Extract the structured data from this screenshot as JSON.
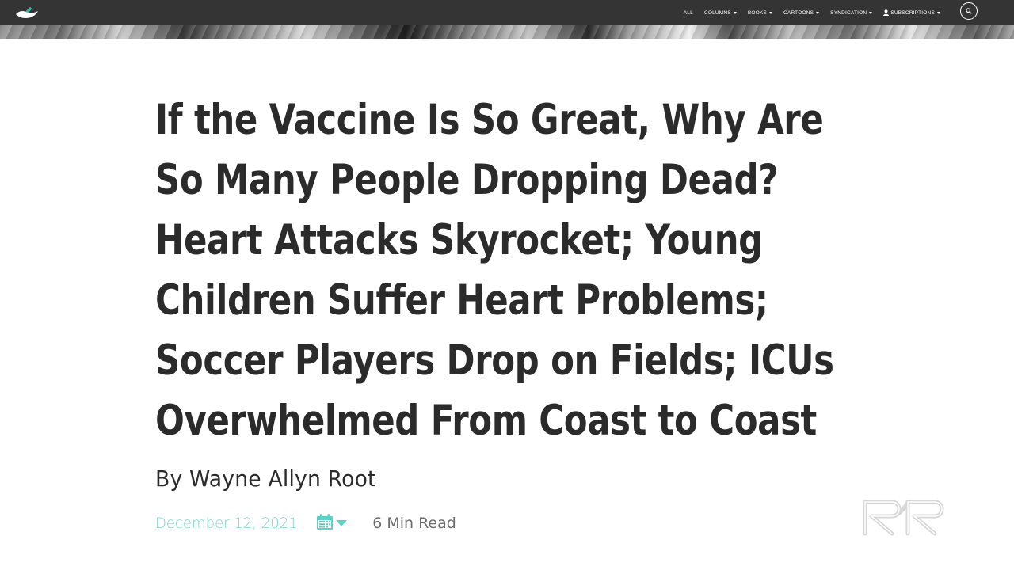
{
  "navbar": {
    "logo_icon": "bird-logo-icon",
    "items": [
      {
        "label": "ALL",
        "has_dropdown": false
      },
      {
        "label": "COLUMNS",
        "has_dropdown": true
      },
      {
        "label": "BOOKS",
        "has_dropdown": true
      },
      {
        "label": "CARTOONS",
        "has_dropdown": true
      },
      {
        "label": "SYNDICATION",
        "has_dropdown": true
      },
      {
        "label": "SUBSCRIPTIONS",
        "has_dropdown": true,
        "icon": "user-icon"
      }
    ],
    "search_icon": "search-icon"
  },
  "article": {
    "title": "If the Vaccine Is So Great, Why Are So Many People Dropping Dead? Heart Attacks Skyrocket; Young Children Suffer Heart Problems; Soccer Players Drop on Fields; ICUs Overwhelmed From Coast to Coast",
    "byline": "By Wayne Allyn Root",
    "date": "December 12, 2021",
    "read_time": "6 Min Read"
  },
  "colors": {
    "navbar_bg": "#343434",
    "accent_teal": "#7dd7cf",
    "headline": "#2b2b2b"
  },
  "watermark": "rr-logo-watermark"
}
